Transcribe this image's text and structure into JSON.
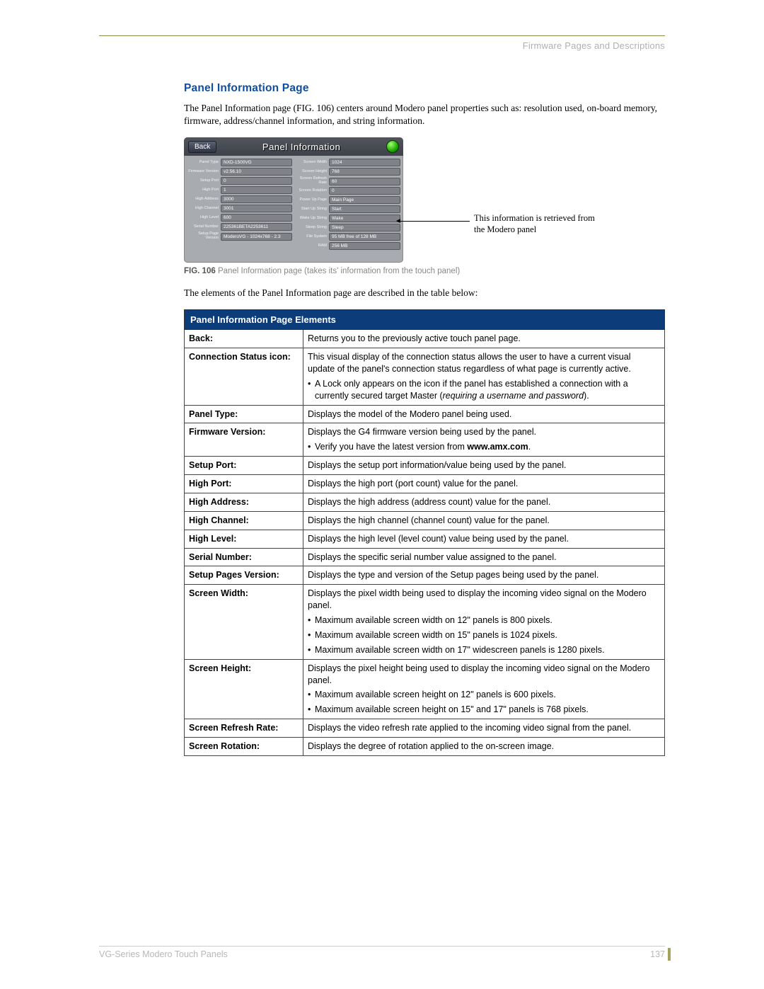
{
  "header": {
    "section": "Firmware Pages and Descriptions"
  },
  "title": "Panel Information Page",
  "intro": "The Panel Information page (FIG. 106) centers around Modero panel properties such as: resolution used, on-board memory, firmware, address/channel information, and string information.",
  "screenshot": {
    "back": "Back",
    "title": "Panel Information",
    "leftRows": [
      {
        "label": "Panel Type",
        "value": "NXD-1500VG"
      },
      {
        "label": "Firmware Version",
        "value": "v2.56.10"
      },
      {
        "label": "Setup Port",
        "value": "0"
      },
      {
        "label": "High Port",
        "value": "1"
      },
      {
        "label": "High Address",
        "value": "3000"
      },
      {
        "label": "High Channel",
        "value": "3001"
      },
      {
        "label": "High Level",
        "value": "600"
      },
      {
        "label": "Serial Number",
        "value": "225361BETA2253611"
      },
      {
        "label": "Setup Page Version",
        "value": "ModeroVG - 1024x768 - 2.3"
      }
    ],
    "rightRows": [
      {
        "label": "Screen Width",
        "value": "1024"
      },
      {
        "label": "Screen Height",
        "value": "768"
      },
      {
        "label": "Screen Refresh Rate",
        "value": "60"
      },
      {
        "label": "Screen Rotation",
        "value": "0"
      },
      {
        "label": "Power Up Page",
        "value": "Main Page"
      },
      {
        "label": "Start Up String",
        "value": "Start"
      },
      {
        "label": "Wake Up String",
        "value": "Wake"
      },
      {
        "label": "Sleep String",
        "value": "Sleep"
      },
      {
        "label": "File System",
        "value": "95 MB free of 128 MB"
      },
      {
        "label": "RAM",
        "value": "256 MB"
      }
    ]
  },
  "annotation": {
    "line1": "This information is retrieved from",
    "line2": " the Modero panel"
  },
  "caption": {
    "bold": "FIG. 106",
    "rest": "  Panel Information page (takes its' information from the touch panel)"
  },
  "tableIntro": "The elements of the Panel Information page are described in the table below:",
  "tableHeader": "Panel Information Page Elements",
  "rows": [
    {
      "label": "Back:",
      "content": [
        {
          "t": "p",
          "v": "Returns you to the previously active touch panel page."
        }
      ]
    },
    {
      "label": "Connection Status icon:",
      "content": [
        {
          "t": "p",
          "v": "This visual display of the connection status allows the user to have a current visual update of the panel's connection status regardless of what page is currently active."
        },
        {
          "t": "b",
          "v": "A Lock only appears on the icon if the panel has established a connection with a currently secured target Master (",
          "i": "requiring a username and password",
          "after": ")."
        }
      ]
    },
    {
      "label": "Panel Type:",
      "content": [
        {
          "t": "p",
          "v": "Displays the model of the Modero panel being used."
        }
      ]
    },
    {
      "label": "Firmware Version:",
      "content": [
        {
          "t": "p",
          "v": "Displays the G4 firmware version being used by the panel."
        },
        {
          "t": "b",
          "v": "Verify you have the latest version from ",
          "bold": "www.amx.com",
          "after": "."
        }
      ]
    },
    {
      "label": "Setup Port:",
      "content": [
        {
          "t": "p",
          "v": "Displays the setup port information/value being used by the panel."
        }
      ]
    },
    {
      "label": "High Port:",
      "content": [
        {
          "t": "p",
          "v": "Displays the high port (port count) value for the panel."
        }
      ]
    },
    {
      "label": "High Address:",
      "content": [
        {
          "t": "p",
          "v": "Displays the high address (address count) value for the panel."
        }
      ]
    },
    {
      "label": "High Channel:",
      "content": [
        {
          "t": "p",
          "v": "Displays the high channel (channel count) value for the panel."
        }
      ]
    },
    {
      "label": "High Level:",
      "content": [
        {
          "t": "p",
          "v": "Displays the high level (level count) value being used by the panel."
        }
      ]
    },
    {
      "label": "Serial Number:",
      "content": [
        {
          "t": "p",
          "v": "Displays the specific serial number value assigned to the panel."
        }
      ]
    },
    {
      "label": "Setup Pages Version:",
      "content": [
        {
          "t": "p",
          "v": "Displays the type and version of the Setup pages being used by the panel."
        }
      ]
    },
    {
      "label": "Screen Width:",
      "content": [
        {
          "t": "p",
          "v": "Displays the pixel width being used to display the incoming video signal on the Modero panel."
        },
        {
          "t": "b",
          "v": "Maximum available screen width on 12\" panels is 800 pixels."
        },
        {
          "t": "b",
          "v": "Maximum available screen width on 15\" panels is 1024 pixels."
        },
        {
          "t": "b",
          "v": "Maximum available screen width on 17\" widescreen panels is 1280 pixels."
        }
      ]
    },
    {
      "label": "Screen Height:",
      "content": [
        {
          "t": "p",
          "v": "Displays the pixel height being used to display the incoming video signal on the Modero panel."
        },
        {
          "t": "b",
          "v": "Maximum available screen height on 12\" panels is 600 pixels."
        },
        {
          "t": "b",
          "v": "Maximum available screen height on 15\" and 17\" panels is 768 pixels."
        }
      ]
    },
    {
      "label": "Screen Refresh Rate:",
      "content": [
        {
          "t": "p",
          "v": "Displays the video refresh rate applied to the incoming video signal from the panel."
        }
      ]
    },
    {
      "label": "Screen Rotation:",
      "content": [
        {
          "t": "p",
          "v": "Displays the degree of rotation applied to the on-screen image."
        }
      ]
    }
  ],
  "footer": {
    "left": "VG-Series Modero Touch Panels",
    "right": "137"
  }
}
